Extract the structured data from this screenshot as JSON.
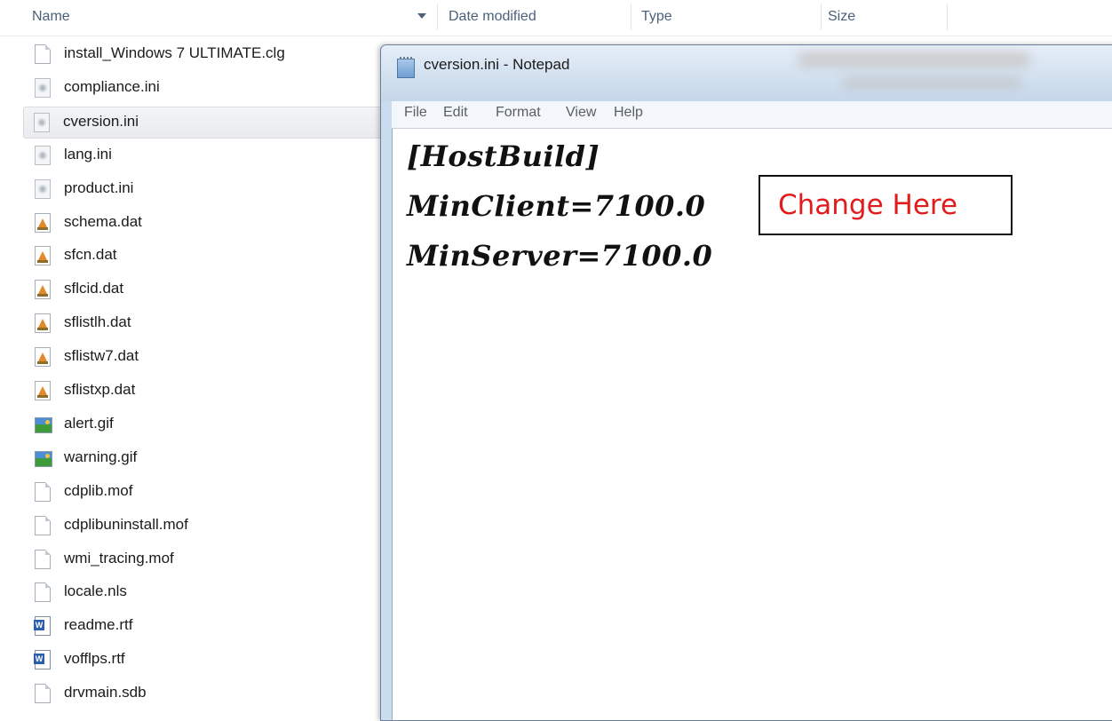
{
  "header": {
    "columns": [
      "Name",
      "Date modified",
      "Type",
      "Size"
    ]
  },
  "files": [
    {
      "name": "install_Windows 7 ULTIMATE.clg",
      "icon": "blank-file-icon"
    },
    {
      "name": "compliance.ini",
      "icon": "settings-file-icon"
    },
    {
      "name": "cversion.ini",
      "icon": "settings-file-icon",
      "selected": true
    },
    {
      "name": "lang.ini",
      "icon": "settings-file-icon"
    },
    {
      "name": "product.ini",
      "icon": "settings-file-icon"
    },
    {
      "name": "schema.dat",
      "icon": "dat-file-icon"
    },
    {
      "name": "sfcn.dat",
      "icon": "dat-file-icon"
    },
    {
      "name": "sflcid.dat",
      "icon": "dat-file-icon"
    },
    {
      "name": "sflistlh.dat",
      "icon": "dat-file-icon"
    },
    {
      "name": "sflistw7.dat",
      "icon": "dat-file-icon"
    },
    {
      "name": "sflistxp.dat",
      "icon": "dat-file-icon"
    },
    {
      "name": "alert.gif",
      "icon": "image-file-icon"
    },
    {
      "name": "warning.gif",
      "icon": "image-file-icon"
    },
    {
      "name": "cdplib.mof",
      "icon": "blank-file-icon"
    },
    {
      "name": "cdplibuninstall.mof",
      "icon": "blank-file-icon"
    },
    {
      "name": "wmi_tracing.mof",
      "icon": "blank-file-icon"
    },
    {
      "name": "locale.nls",
      "icon": "blank-file-icon"
    },
    {
      "name": "readme.rtf",
      "icon": "word-file-icon"
    },
    {
      "name": "vofflps.rtf",
      "icon": "word-file-icon"
    },
    {
      "name": "drvmain.sdb",
      "icon": "blank-file-icon"
    }
  ],
  "notepad": {
    "title": "cversion.ini - Notepad",
    "menu": [
      "File",
      "Edit",
      "Format",
      "View",
      "Help"
    ],
    "lines": [
      "[HostBuild]",
      "MinClient=7100.0",
      "MinServer=7100.0"
    ],
    "annotation": "Change Here",
    "annotation_color": "#e21c1c"
  }
}
